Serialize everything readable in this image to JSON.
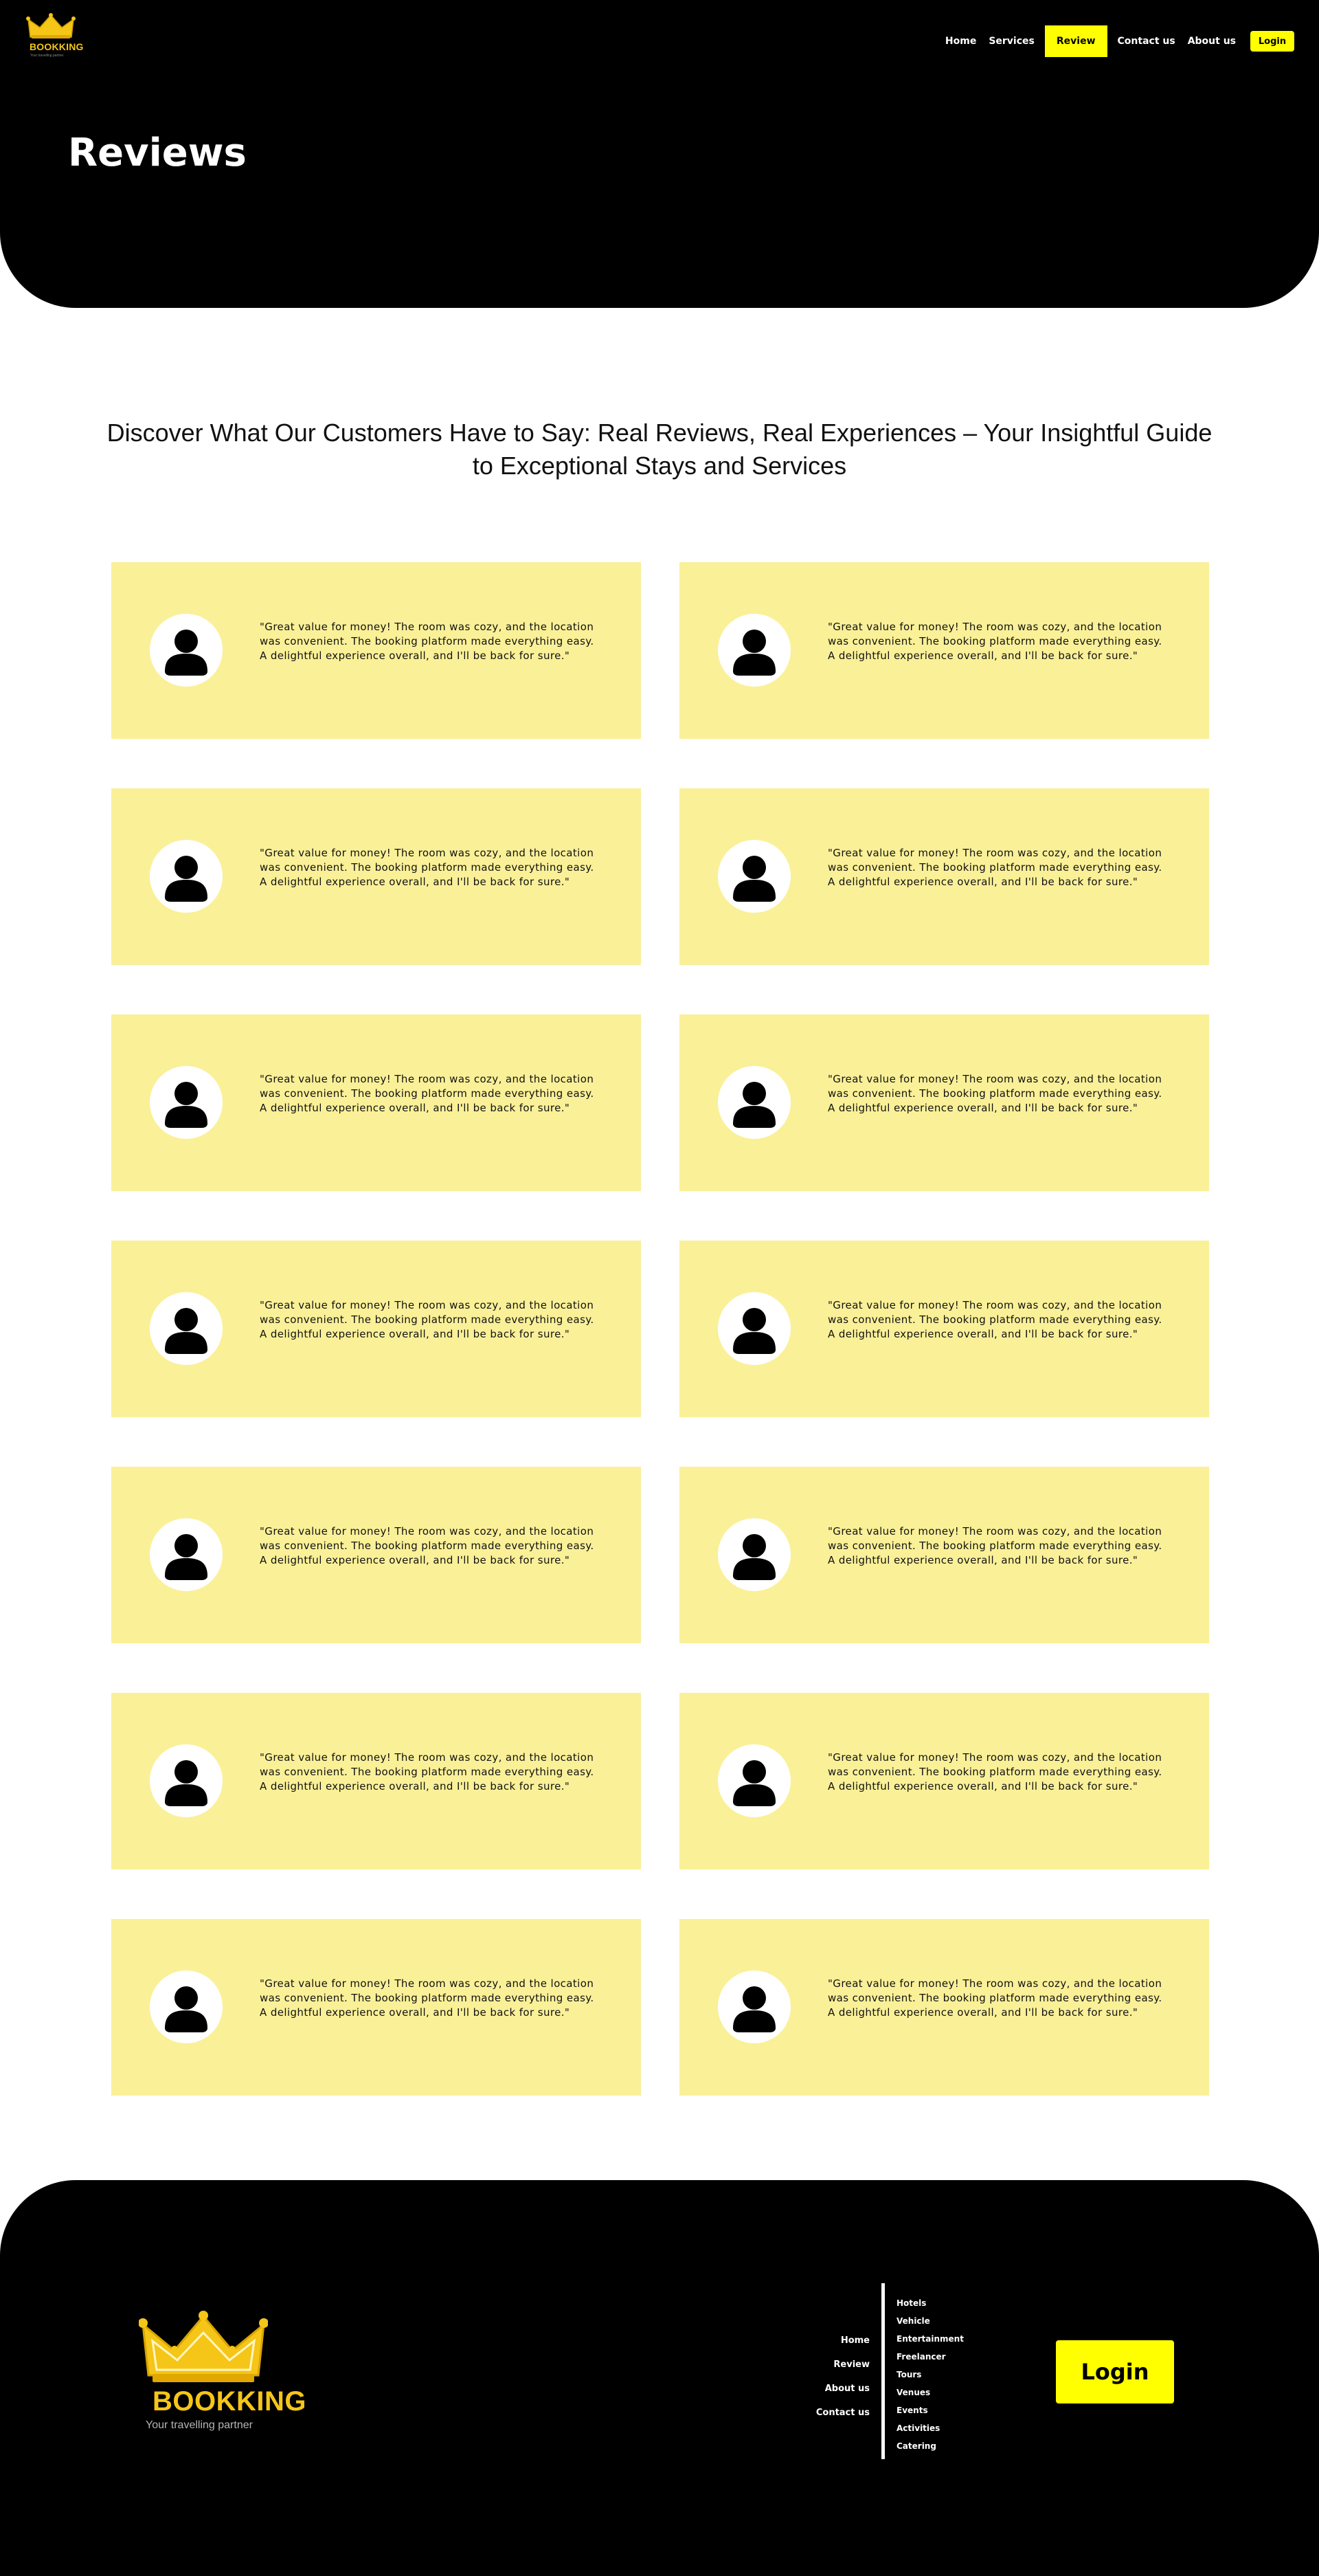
{
  "brand": {
    "name": "BOOKKING",
    "tagline": "Your travelling partner",
    "color": "#f5c518"
  },
  "nav": {
    "links": [
      "Home",
      "Services",
      "Review",
      "Contact us",
      "About us"
    ],
    "active": "Review",
    "login_label": "Login",
    "accent_color": "#ffff00"
  },
  "hero": {
    "title": "Reviews"
  },
  "intro": {
    "text": "Discover What Our Customers Have to Say: Real Reviews, Real Experiences – Your Insightful Guide to Exceptional Stays and Services"
  },
  "reviews": [
    {
      "avatar_icon": "user-icon",
      "text": "\"Great value for money! The room was cozy, and the location was convenient. The booking platform made everything easy. A delightful experience overall, and I'll be back for sure.\""
    },
    {
      "avatar_icon": "user-icon",
      "text": "\"Great value for money! The room was cozy, and the location was convenient. The booking platform made everything easy. A delightful experience overall, and I'll be back for sure.\""
    },
    {
      "avatar_icon": "user-icon",
      "text": "\"Great value for money! The room was cozy, and the location was convenient. The booking platform made everything easy. A delightful experience overall, and I'll be back for sure.\""
    },
    {
      "avatar_icon": "user-icon",
      "text": "\"Great value for money! The room was cozy, and the location was convenient. The booking platform made everything easy. A delightful experience overall, and I'll be back for sure.\""
    },
    {
      "avatar_icon": "user-icon",
      "text": "\"Great value for money! The room was cozy, and the location was convenient. The booking platform made everything easy. A delightful experience overall, and I'll be back for sure.\""
    },
    {
      "avatar_icon": "user-icon",
      "text": "\"Great value for money! The room was cozy, and the location was convenient. The booking platform made everything easy. A delightful experience overall, and I'll be back for sure.\""
    },
    {
      "avatar_icon": "user-icon",
      "text": "\"Great value for money! The room was cozy, and the location was convenient. The booking platform made everything easy. A delightful experience overall, and I'll be back for sure.\""
    },
    {
      "avatar_icon": "user-icon",
      "text": "\"Great value for money! The room was cozy, and the location was convenient. The booking platform made everything easy. A delightful experience overall, and I'll be back for sure.\""
    },
    {
      "avatar_icon": "user-icon",
      "text": "\"Great value for money! The room was cozy, and the location was convenient. The booking platform made everything easy. A delightful experience overall, and I'll be back for sure.\""
    },
    {
      "avatar_icon": "user-icon",
      "text": "\"Great value for money! The room was cozy, and the location was convenient. The booking platform made everything easy. A delightful experience overall, and I'll be back for sure.\""
    },
    {
      "avatar_icon": "user-icon",
      "text": "\"Great value for money! The room was cozy, and the location was convenient. The booking platform made everything easy. A delightful experience overall, and I'll be back for sure.\""
    },
    {
      "avatar_icon": "user-icon",
      "text": "\"Great value for money! The room was cozy, and the location was convenient. The booking platform made everything easy. A delightful experience overall, and I'll be back for sure.\""
    },
    {
      "avatar_icon": "user-icon",
      "text": "\"Great value for money! The room was cozy, and the location was convenient. The booking platform made everything easy. A delightful experience overall, and I'll be back for sure.\""
    },
    {
      "avatar_icon": "user-icon",
      "text": "\"Great value for money! The room was cozy, and the location was convenient. The booking platform made everything easy. A delightful experience overall, and I'll be back for sure.\""
    }
  ],
  "review_card_color": "#faf098",
  "footer": {
    "links": [
      "Home",
      "Review",
      "About us",
      "Contact us"
    ],
    "services": [
      "Hotels",
      "Vehicle",
      "Entertainment",
      "Freelancer",
      "Tours",
      "Venues",
      "Events",
      "Activities",
      "Catering"
    ],
    "login_label": "Login"
  }
}
